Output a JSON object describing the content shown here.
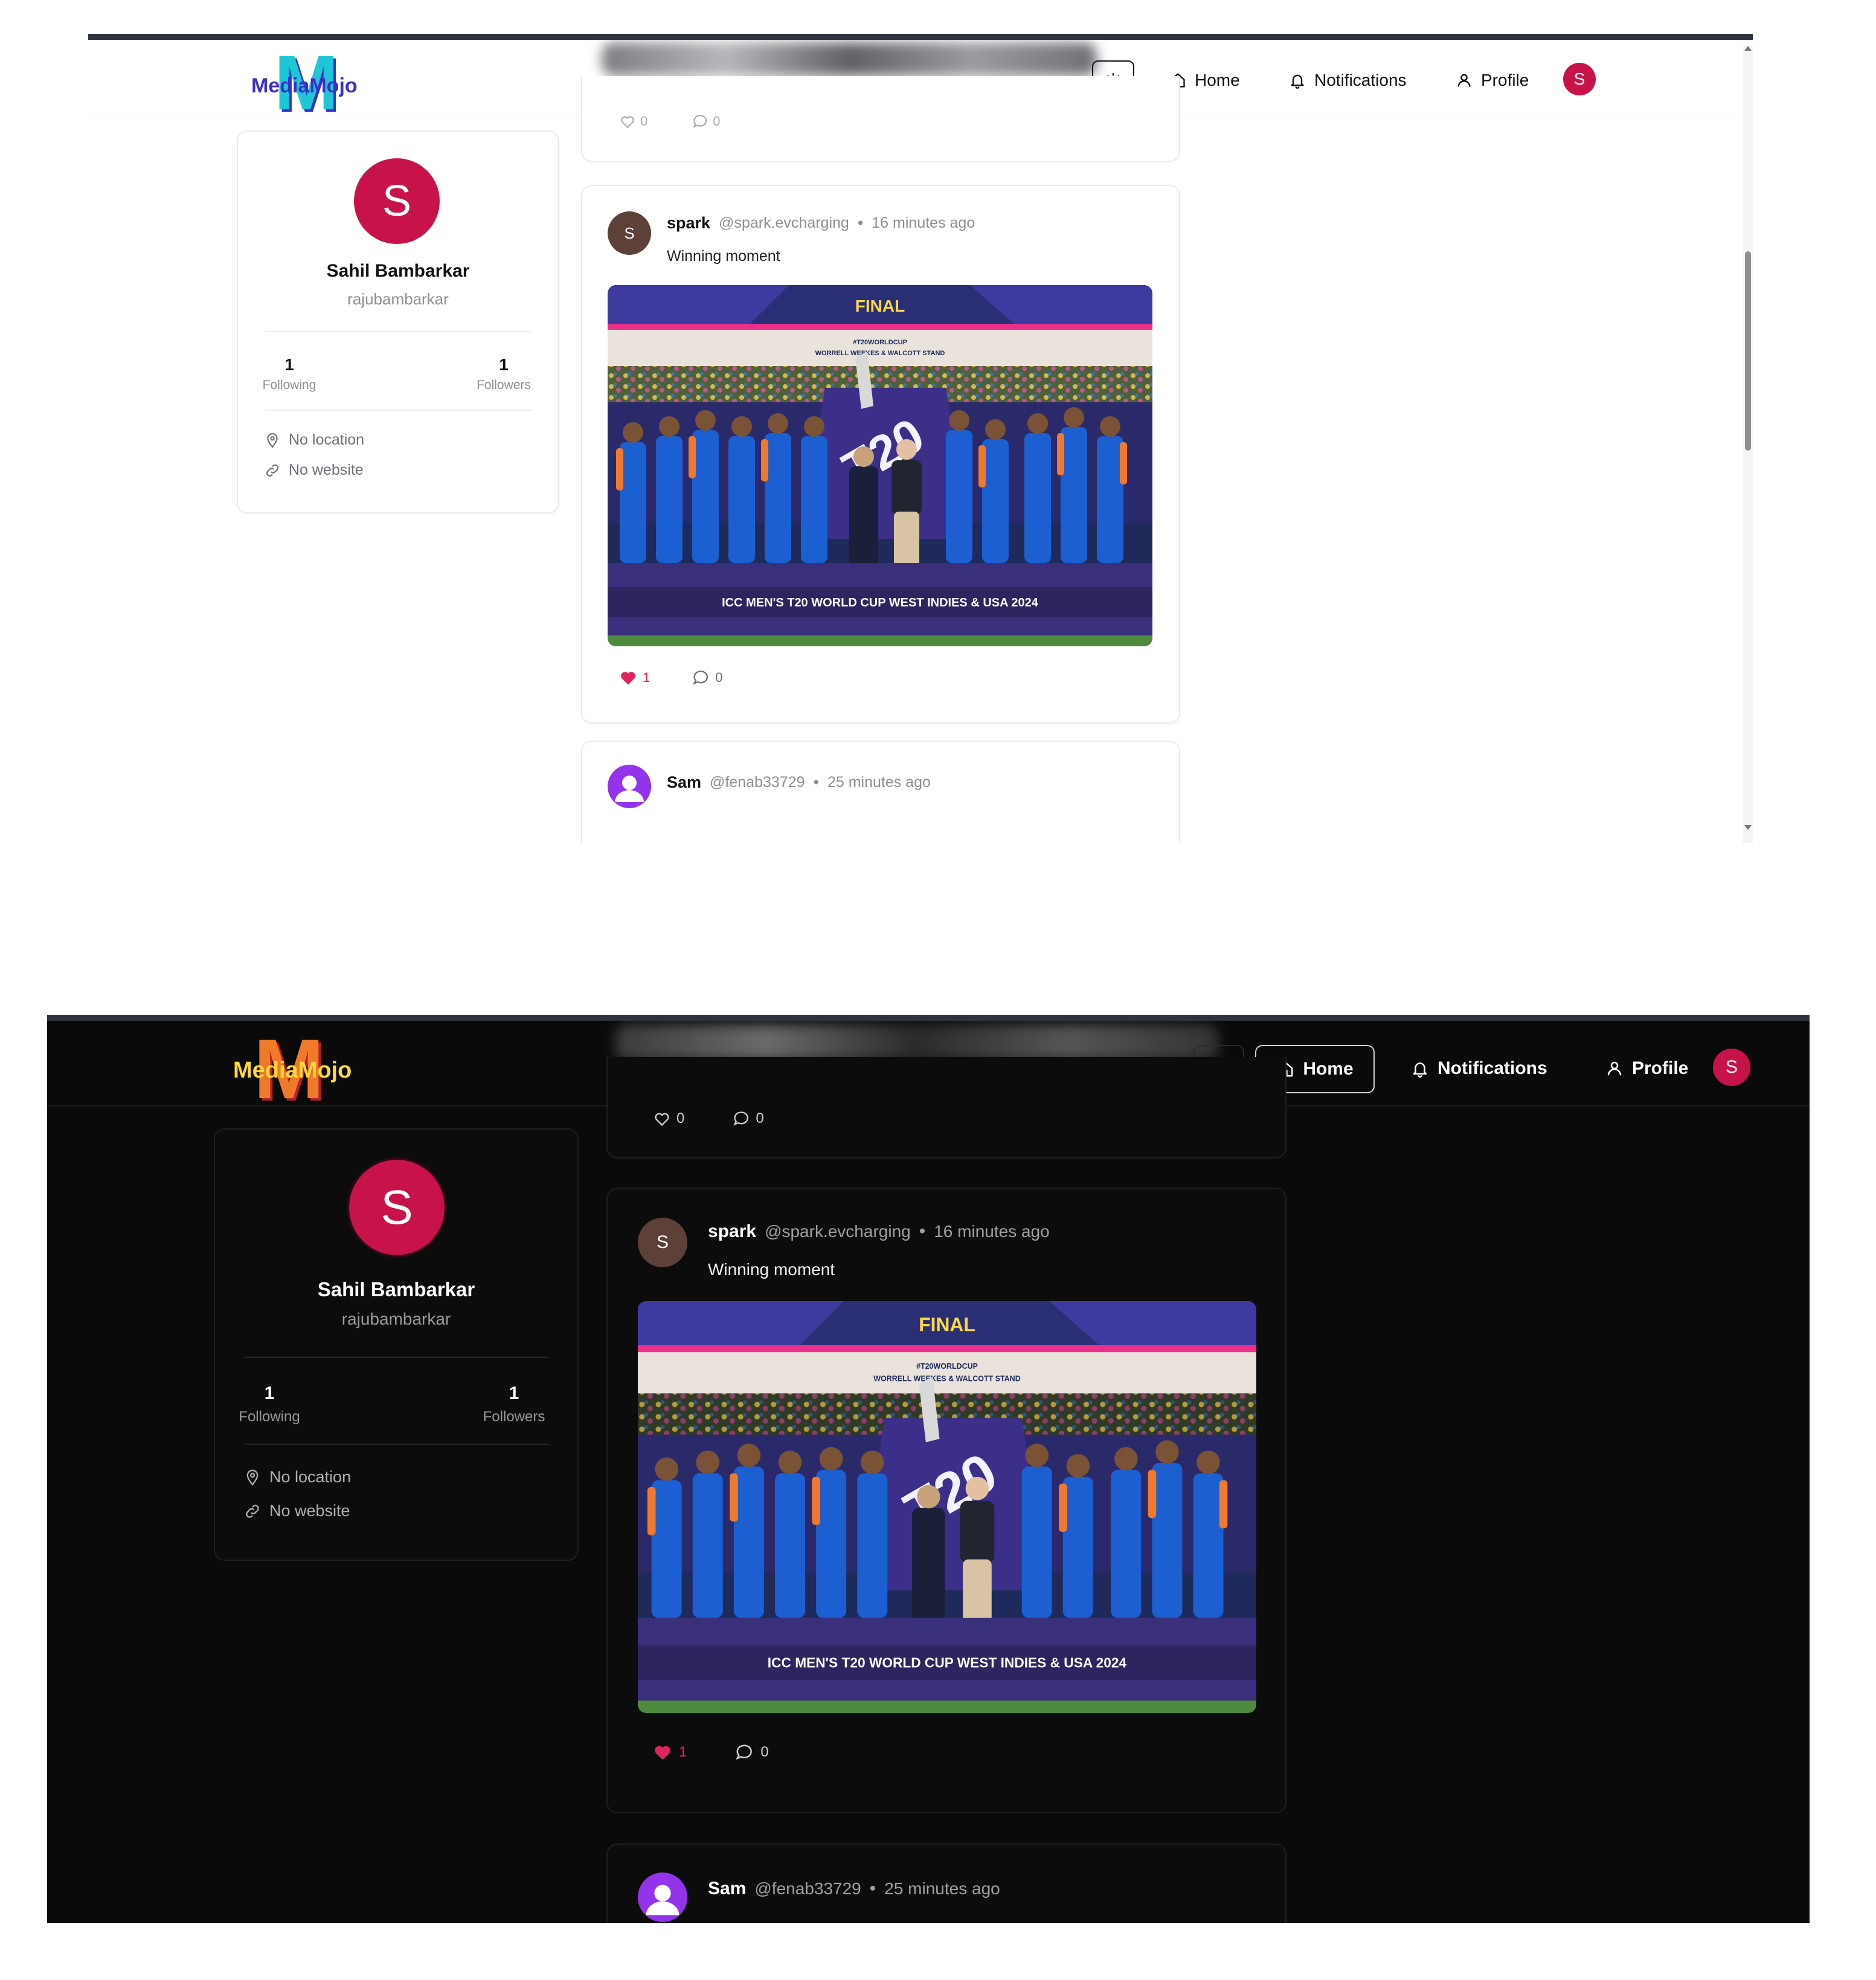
{
  "app": {
    "logo_text": "MediaMojo",
    "logo_letter": "M"
  },
  "nav": {
    "home": "Home",
    "notifications": "Notifications",
    "profile": "Profile",
    "avatar_initial": "S"
  },
  "profile_card": {
    "avatar_initial": "S",
    "name": "Sahil Bambarkar",
    "username": "rajubambarkar",
    "following_count": "1",
    "following_label": "Following",
    "followers_count": "1",
    "followers_label": "Followers",
    "location": "No location",
    "website": "No website"
  },
  "previous_post": {
    "likes": "0",
    "comments": "0"
  },
  "post": {
    "avatar_initial": "S",
    "author": "spark",
    "handle": "@spark.evcharging",
    "separator": "•",
    "time": "16 minutes ago",
    "text": "Winning moment",
    "image_top_banner": "FINAL",
    "image_hashtag": "#T20WORLDCUP",
    "image_stand": "WORRELL WEEKES & WALCOTT STAND",
    "image_logo": "T20",
    "image_bottom_banner": "ICC MEN'S T20 WORLD CUP WEST INDIES & USA 2024",
    "likes": "1",
    "comments": "0"
  },
  "next_post": {
    "author": "Sam",
    "handle": "@fenab33729",
    "separator": "•",
    "time": "25 minutes ago"
  },
  "colors": {
    "accent_avatar": "#c8134a",
    "like_red": "#e0245e",
    "post_avatar_brown": "#5d4037",
    "sam_avatar_purple": "#9333ea"
  }
}
